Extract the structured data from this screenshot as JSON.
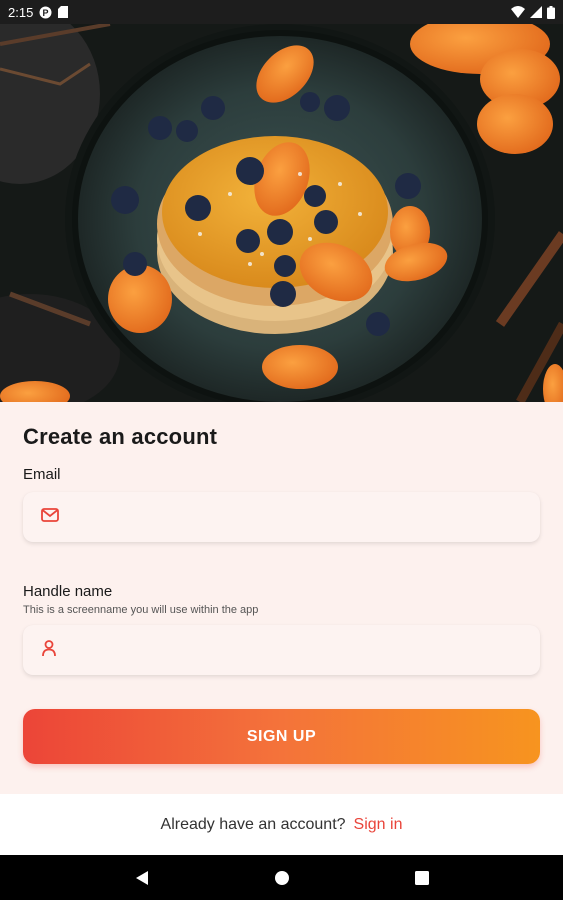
{
  "status_bar": {
    "time": "2:15",
    "icons": [
      "p-icon",
      "sd-card-icon",
      "wifi-icon",
      "signal-icon",
      "battery-icon"
    ]
  },
  "hero": {
    "description_icon": "pancakes-photo"
  },
  "form": {
    "title": "Create an account",
    "email": {
      "label": "Email",
      "value": "",
      "placeholder": "",
      "icon": "mail-icon"
    },
    "handle": {
      "label": "Handle name",
      "help": "This is a screenname you will use within the app",
      "value": "",
      "placeholder": "",
      "icon": "person-icon"
    },
    "submit_label": "SIGN UP"
  },
  "footer": {
    "prompt": "Already have an account?",
    "signin_label": "Sign in"
  },
  "colors": {
    "accent": "#e9443a",
    "gradient_start": "#ec4538",
    "gradient_end": "#f7941f",
    "panel_bg": "#fdf1ee"
  },
  "nav": {
    "buttons": [
      "back-icon",
      "home-icon",
      "recents-icon"
    ]
  }
}
